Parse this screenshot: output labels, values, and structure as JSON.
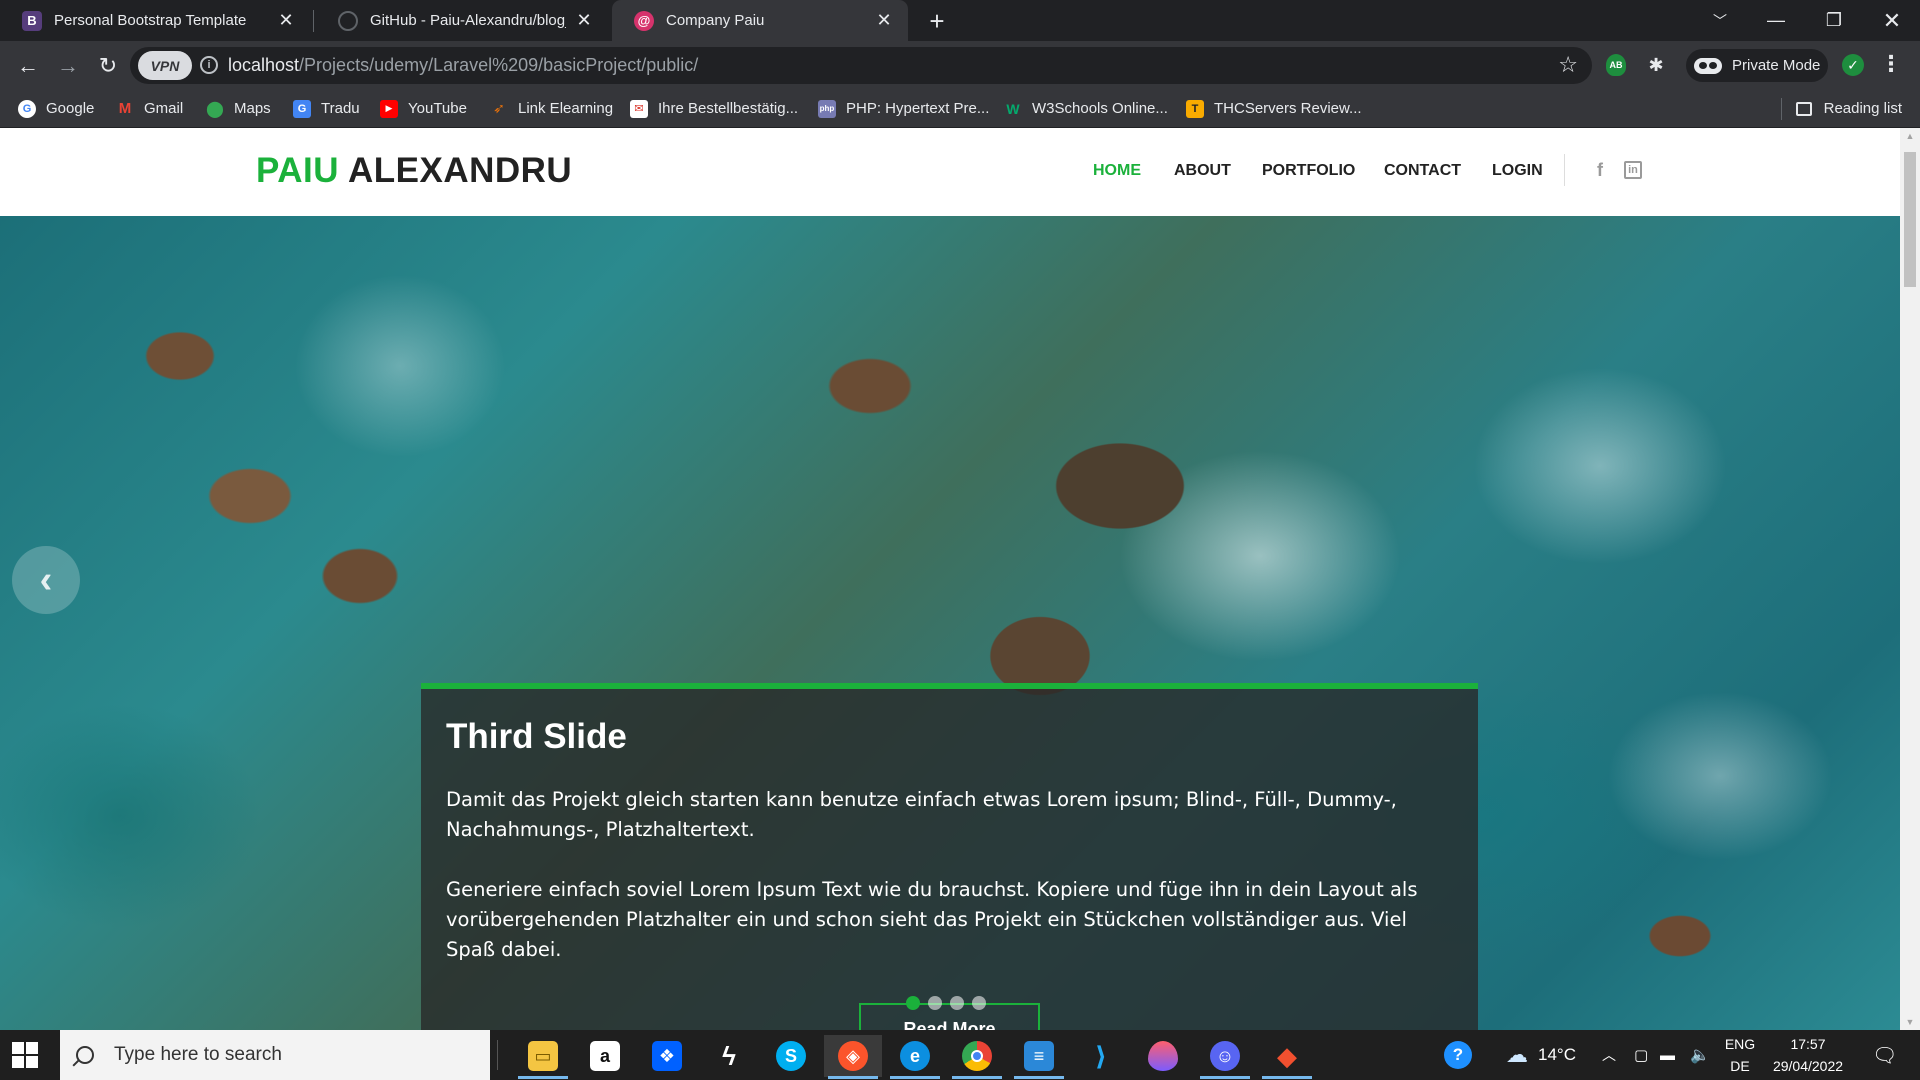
{
  "browser": {
    "tabs": [
      {
        "title": "Personal Bootstrap Template",
        "favicon": "bootstrap-icon",
        "favicon_letter": "B",
        "favicon_color": "#563d7c"
      },
      {
        "title": "GitHub - Paiu-Alexandru/blog_laravel",
        "favicon": "github-icon",
        "favicon_letter": "",
        "favicon_color": "#202124"
      },
      {
        "title": "Company Paiu",
        "favicon": "laravel-icon",
        "favicon_letter": "@",
        "favicon_color": "#d6336c"
      }
    ],
    "address": {
      "vpn_label": "VPN",
      "host": "localhost",
      "path": "/Projects/udemy/Laravel%209/basicProject/public/"
    },
    "private_mode_label": "Private Mode",
    "extension_ab_label": "AB",
    "bookmarks": [
      {
        "label": "Google",
        "icon": "google-icon",
        "color": "#ffffff"
      },
      {
        "label": "Gmail",
        "icon": "gmail-icon",
        "color": "#ea4335"
      },
      {
        "label": "Maps",
        "icon": "maps-icon",
        "color": "#34a853"
      },
      {
        "label": "Tradu",
        "icon": "translate-icon",
        "color": "#4285f4"
      },
      {
        "label": "YouTube",
        "icon": "youtube-icon",
        "color": "#ff0000"
      },
      {
        "label": "Link Elearning",
        "icon": "elearning-icon",
        "color": "#e8710a"
      },
      {
        "label": "Ihre Bestellbestätig...",
        "icon": "mail-icon",
        "color": "#d93025"
      },
      {
        "label": "PHP: Hypertext Pre...",
        "icon": "php-icon",
        "color": "#777bb3"
      },
      {
        "label": "W3Schools Online...",
        "icon": "w3schools-icon",
        "color": "#04aa6d"
      },
      {
        "label": "THCServers Review...",
        "icon": "thcservers-icon",
        "color": "#f9ab00"
      }
    ],
    "reading_list_label": "Reading list"
  },
  "site": {
    "logo_accent": "PAIU",
    "logo_rest": "ALEXANDRU",
    "nav": [
      "HOME",
      "ABOUT",
      "PORTFOLIO",
      "CONTACT",
      "LOGIN"
    ],
    "active_nav": "HOME",
    "accent_color": "#1bb13b",
    "social": [
      "facebook-icon",
      "linkedin-icon"
    ],
    "slider": {
      "title": "Third Slide",
      "paragraph1": "Damit das Projekt gleich starten kann benutze einfach etwas Lorem ipsum; Blind-, Füll-, Dummy-, Nachahmungs-, Platzhaltertext.",
      "paragraph2": "Generiere einfach soviel Lorem Ipsum Text wie du brauchst. Kopiere und füge ihn in dein Layout als vorübergehenden Platzhalter ein und schon sieht das Projekt ein Stückchen vollständiger aus. Viel Spaß dabei.",
      "button_label": "Read More",
      "slide_count": 4,
      "active_slide": 1
    }
  },
  "taskbar": {
    "search_placeholder": "Type here to search",
    "apps": [
      "file-explorer-icon",
      "amazon-icon",
      "dropbox-icon",
      "app-icon",
      "skype-icon",
      "brave-icon",
      "edge-icon",
      "chrome-icon",
      "notepad-icon",
      "vscode-icon",
      "paint-icon",
      "discord-icon",
      "git-icon"
    ],
    "weather": "14°C",
    "lang_top": "ENG",
    "lang_bottom": "DE",
    "time": "17:57",
    "date": "29/04/2022"
  }
}
